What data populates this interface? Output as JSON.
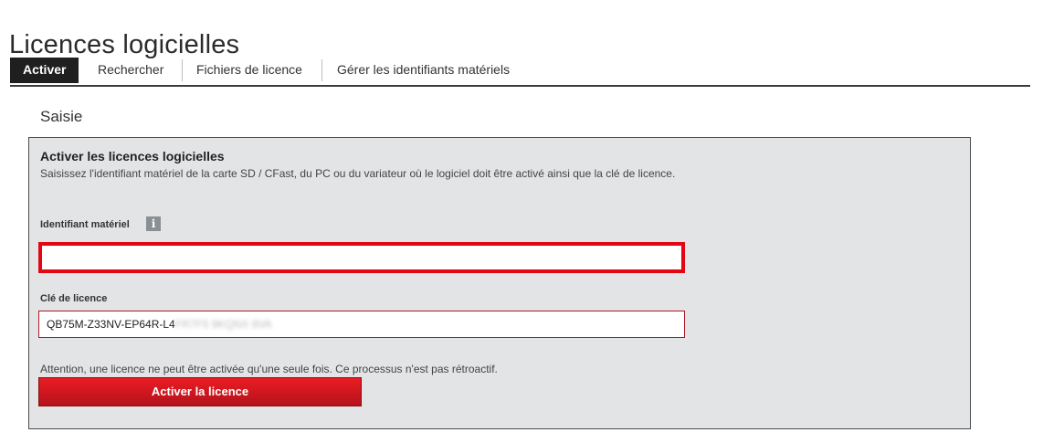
{
  "page_title": "Licences logicielles",
  "tabs": [
    {
      "label": "Activer",
      "active": true
    },
    {
      "label": "Rechercher",
      "active": false
    },
    {
      "label": "Fichiers de licence",
      "active": false
    },
    {
      "label": "Gérer les identifiants matériels",
      "active": false
    }
  ],
  "section_title": "Saisie",
  "panel": {
    "heading": "Activer les licences logicielles",
    "description": "Saisissez l'identifiant matériel de la carte SD / CFast, du PC ou du variateur où le logiciel doit être activé ainsi que la clé de licence.",
    "hardware_id": {
      "label": "Identifiant matériel",
      "info_icon": "info-icon",
      "value": "",
      "state": "error"
    },
    "license_key": {
      "label": "Clé de licence",
      "value_visible": "QB75M-Z33NV-EP64R-L4",
      "value_blurred": "FR7F5 9KQNX 8VA"
    },
    "warning": "Attention, une licence ne peut être activée qu'une seule fois. Ce processus n'est pas rétroactif.",
    "activate_button": "Activer la licence"
  },
  "colors": {
    "accent_red": "#e30613",
    "tab_active_bg": "#1f1f1f",
    "panel_bg": "#e2e4e5"
  }
}
